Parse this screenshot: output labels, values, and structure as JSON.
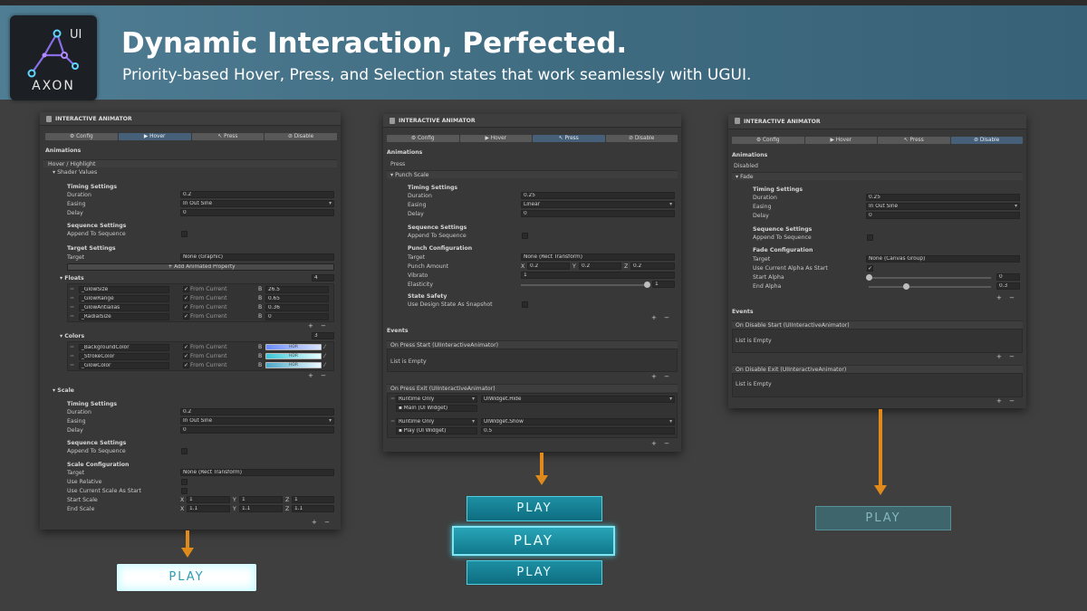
{
  "header": {
    "logo_ui": "UI",
    "logo_name": "AXON",
    "title": "Dynamic Interaction, Perfected.",
    "subtitle": "Priority-based Hover, Press, and Selection states that work seamlessly with UGUI."
  },
  "colors": {
    "accent": "#e08a1c",
    "banner": "#46738a",
    "tab_active": "#46607a"
  },
  "panel1": {
    "title": "INTERACTIVE ANIMATOR",
    "tabs": [
      "Config",
      "Hover",
      "Press",
      "Disable"
    ],
    "active_tab": "Hover",
    "animations_label": "Animations",
    "state_label": "Hover / Highlight",
    "shader_label": "Shader Values",
    "timing_label": "Timing Settings",
    "duration_label": "Duration",
    "duration": "0.2",
    "easing_label": "Easing",
    "easing": "In Out Sine",
    "delay_label": "Delay",
    "delay": "0",
    "sequence_label": "Sequence Settings",
    "append_label": "Append To Sequence",
    "target_settings_label": "Target Settings",
    "target_label": "Target",
    "target": "None (Graphic)",
    "add_button": "+ Add Animated Property",
    "floats_label": "Floats",
    "floats_count": "4",
    "floats": [
      {
        "name": "_GlowSize",
        "from": "From Current",
        "b": "B",
        "value": "26.5"
      },
      {
        "name": "_GlowRange",
        "from": "From Current",
        "b": "B",
        "value": "0.65"
      },
      {
        "name": "_GlowAntialias",
        "from": "From Current",
        "b": "B",
        "value": "0.36"
      },
      {
        "name": "_RadialSize",
        "from": "From Current",
        "b": "B",
        "value": "0"
      }
    ],
    "colors_label": "Colors",
    "colors_count": "3",
    "colors": [
      {
        "name": "_BackgroundColor",
        "from": "From Current",
        "b": "B",
        "hdr": "HDR"
      },
      {
        "name": "_StrokeColor",
        "from": "From Current",
        "b": "B",
        "hdr": "HDR"
      },
      {
        "name": "_GlowColor",
        "from": "From Current",
        "b": "B",
        "hdr": "HDR"
      }
    ],
    "scale_label": "Scale",
    "scale_timing_label": "Timing Settings",
    "scale_duration_label": "Duration",
    "scale_duration": "0.2",
    "scale_easing_label": "Easing",
    "scale_easing": "In Out Sine",
    "scale_delay_label": "Delay",
    "scale_delay": "0",
    "scale_sequence_label": "Sequence Settings",
    "scale_append_label": "Append To Sequence",
    "scale_config_label": "Scale Configuration",
    "scale_target_label": "Target",
    "scale_target": "None (Rect Transform)",
    "use_relative_label": "Use Relative",
    "use_current_label": "Use Current Scale As Start",
    "start_scale_label": "Start Scale",
    "start_scale": {
      "x": "1",
      "y": "1",
      "z": "1"
    },
    "end_scale_label": "End Scale",
    "end_scale": {
      "x": "1.1",
      "y": "1.1",
      "z": "1.1"
    },
    "pm": "+ −"
  },
  "panel2": {
    "title": "INTERACTIVE ANIMATOR",
    "tabs": [
      "Config",
      "Hover",
      "Press",
      "Disable"
    ],
    "active_tab": "Press",
    "animations_label": "Animations",
    "state_label": "Press",
    "punch_label": "Punch Scale",
    "timing_label": "Timing Settings",
    "duration_label": "Duration",
    "duration": "0.25",
    "easing_label": "Easing",
    "easing": "Linear",
    "delay_label": "Delay",
    "delay": "0",
    "sequence_label": "Sequence Settings",
    "append_label": "Append To Sequence",
    "punch_config_label": "Punch Configuration",
    "target_label": "Target",
    "target": "None (Rect Transform)",
    "punch_amount_label": "Punch Amount",
    "punch_amount": {
      "x": "0.2",
      "y": "0.2",
      "z": "0.2"
    },
    "vibrato_label": "Vibrato",
    "vibrato": "1",
    "elasticity_label": "Elasticity",
    "elasticity": "1",
    "safety_label": "State Safety",
    "snapshot_label": "Use Design State As Snapshot",
    "events_label": "Events",
    "event1_title": "On Press Start (UIInteractiveAnimator)",
    "event1_empty": "List is Empty",
    "event2_title": "On Press Exit (UIInteractiveAnimator)",
    "event2_rows": [
      {
        "mode": "Runtime Only",
        "func": "UIWidget.Hide",
        "obj": "Main (UI Widget)",
        "arg": ""
      },
      {
        "mode": "Runtime Only",
        "func": "UIWidget.Show",
        "obj": "Play (UI Widget)",
        "arg": "0.5"
      }
    ],
    "pm": "+ −"
  },
  "panel3": {
    "title": "INTERACTIVE ANIMATOR",
    "tabs": [
      "Config",
      "Hover",
      "Press",
      "Disable"
    ],
    "active_tab": "Disable",
    "animations_label": "Animations",
    "state_label": "Disabled",
    "fade_label": "Fade",
    "timing_label": "Timing Settings",
    "duration_label": "Duration",
    "duration": "0.25",
    "easing_label": "Easing",
    "easing": "In Out Sine",
    "delay_label": "Delay",
    "delay": "0",
    "sequence_label": "Sequence Settings",
    "append_label": "Append To Sequence",
    "fade_config_label": "Fade Configuration",
    "target_label": "Target",
    "target": "None (Canvas Group)",
    "use_current_alpha_label": "Use Current Alpha As Start",
    "start_alpha_label": "Start Alpha",
    "start_alpha": "0",
    "end_alpha_label": "End Alpha",
    "end_alpha": "0.3",
    "events_label": "Events",
    "event1_title": "On Disable Start (UIInteractiveAnimator)",
    "event1_empty": "List is Empty",
    "event2_title": "On Disable Exit (UIInteractiveAnimator)",
    "event2_empty": "List is Empty",
    "pm": "+ −"
  },
  "buttons": {
    "play": "PLAY"
  }
}
